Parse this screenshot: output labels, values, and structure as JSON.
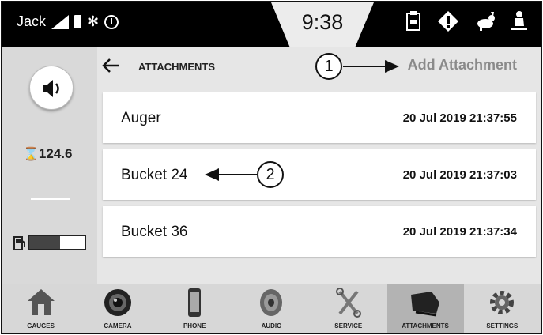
{
  "status": {
    "operator": "Jack",
    "bluetooth": "✻",
    "time": "9:38",
    "icons": [
      "clipboard-icon",
      "warning-diamond-icon",
      "rabbit-speed-icon",
      "seat-icon",
      "operator-lock-icon"
    ]
  },
  "left": {
    "hour_glyph": "⌛",
    "hour_value": "124.6",
    "fuel_level": 0.55
  },
  "header": {
    "title": "ATTACHMENTS",
    "add_label": "Add Attachment"
  },
  "attachments": [
    {
      "name": "Auger",
      "date": "20 Jul 2019 21:37:55"
    },
    {
      "name": "Bucket 24",
      "date": "20 Jul 2019 21:37:03"
    },
    {
      "name": "Bucket 36",
      "date": "20 Jul 2019 21:37:34"
    }
  ],
  "callouts": [
    "1",
    "2"
  ],
  "nav": [
    {
      "label": "GAUGES",
      "icon": "house-icon"
    },
    {
      "label": "CAMERA",
      "icon": "camera-lens-icon"
    },
    {
      "label": "PHONE",
      "icon": "phone-icon"
    },
    {
      "label": "AUDIO",
      "icon": "speaker-icon"
    },
    {
      "label": "SERVICE",
      "icon": "wrench-icon"
    },
    {
      "label": "ATTACHMENTS",
      "icon": "bucket-icon"
    },
    {
      "label": "SETTINGS",
      "icon": "gear-icon"
    }
  ]
}
